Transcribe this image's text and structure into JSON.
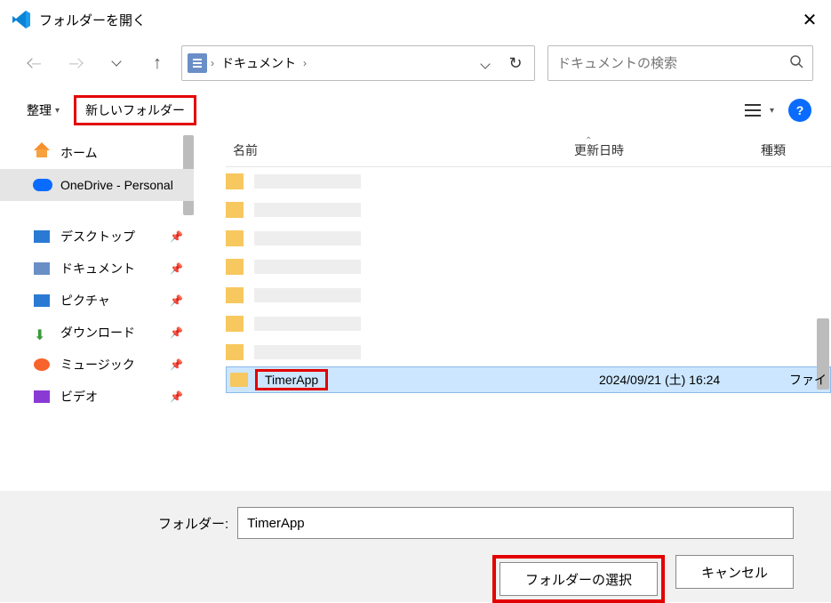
{
  "titlebar": {
    "title": "フォルダーを開く"
  },
  "nav": {
    "path_segment": "ドキュメント",
    "search_placeholder": "ドキュメントの検索"
  },
  "toolbar": {
    "organize": "整理",
    "new_folder": "新しいフォルダー"
  },
  "sidebar": {
    "home": "ホーム",
    "onedrive": "OneDrive - Personal",
    "desktop": "デスクトップ",
    "documents": "ドキュメント",
    "pictures": "ピクチャ",
    "downloads": "ダウンロード",
    "music": "ミュージック",
    "videos": "ビデオ"
  },
  "filelist": {
    "col_name": "名前",
    "col_date": "更新日時",
    "col_type": "種類",
    "selected": {
      "name": "TimerApp",
      "date": "2024/09/21 (土) 16:24",
      "type": "ファイ"
    }
  },
  "footer": {
    "folder_label": "フォルダー:",
    "folder_value": "TimerApp",
    "select_btn": "フォルダーの選択",
    "cancel_btn": "キャンセル"
  }
}
